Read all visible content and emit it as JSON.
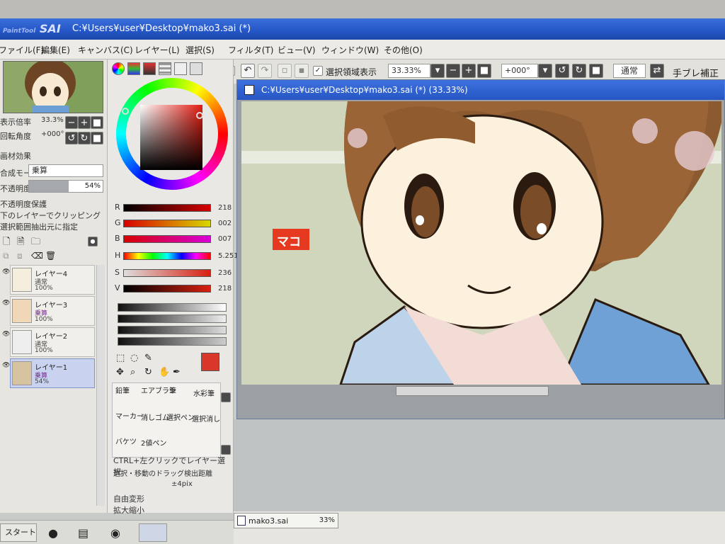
{
  "app": {
    "logo": "SAI",
    "logo_prefix": "PaintTool",
    "title_path": "C:¥Users¥user¥Desktop¥mako3.sai (*)"
  },
  "menu": [
    {
      "label": "ファイル(F)"
    },
    {
      "label": "編集(E)"
    },
    {
      "label": "キャンバス(C)"
    },
    {
      "label": "レイヤー(L)"
    },
    {
      "label": "選択(S)"
    },
    {
      "label": "フィルタ(T)"
    },
    {
      "label": "ビュー(V)"
    },
    {
      "label": "ウィンドウ(W)"
    },
    {
      "label": "その他(O)"
    }
  ],
  "toolbar": {
    "show_selection_label": "選択領域表示",
    "zoom_value": "33.33%",
    "rotation_value": "+000°",
    "blend_mode": "通常",
    "stabilizer_label": "手ブレ補正"
  },
  "navigator": {
    "zoom_label": "表示倍率",
    "zoom_value": "33.3%",
    "rotation_label": "回転角度",
    "rotation_value": "+000°"
  },
  "layer_props": {
    "section_label": "画材効果",
    "blend_label": "合成モード",
    "blend_value": "乗算",
    "opacity_label": "不透明度",
    "opacity_value": "54%",
    "opacity_fraction": 0.54,
    "preserve_opacity": "不透明度保護",
    "clip_label": "下のレイヤーでクリッピング",
    "selection_source": "選択範囲抽出元に指定"
  },
  "layers": [
    {
      "name": "レイヤー4",
      "mode": "通常",
      "opacity": "100%",
      "selected": false
    },
    {
      "name": "レイヤー3",
      "mode": "乗算",
      "opacity": "100%",
      "selected": false
    },
    {
      "name": "レイヤー2",
      "mode": "通常",
      "opacity": "100%",
      "selected": false
    },
    {
      "name": "レイヤー1",
      "mode": "乗算",
      "opacity": "54%",
      "selected": true
    }
  ],
  "color": {
    "current": "#d8372a",
    "R": "218",
    "G": "002",
    "B": "007",
    "H": "5.251",
    "S": "236",
    "V": "218",
    "labels": {
      "R": "R",
      "G": "G",
      "B": "B",
      "H": "H",
      "S": "S",
      "V": "V"
    }
  },
  "tools": [
    {
      "label": "鉛筆"
    },
    {
      "label": "エアブラシ"
    },
    {
      "label": "筆"
    },
    {
      "label": "水彩筆"
    },
    {
      "label": "マーカー"
    },
    {
      "label": "消しゴム"
    },
    {
      "label": "選択ペン"
    },
    {
      "label": "選択消し"
    },
    {
      "label": "バケツ"
    },
    {
      "label": "2値ペン"
    }
  ],
  "options": {
    "ctrl_click": "CTRL+左クリックでレイヤー選択",
    "drag_distance": "選択・移動のドラッグ検出距離",
    "drag_value": "±4pix",
    "free_transform": "自由変形",
    "scale": "拡大縮小"
  },
  "canvas": {
    "title": "C:¥Users¥user¥Desktop¥mako3.sai (*) (33.33%)",
    "name_tag": "マコ"
  },
  "status": {
    "file": "mako3.sai",
    "zoom": "33%"
  },
  "taskbar": {
    "start": "スタート"
  }
}
